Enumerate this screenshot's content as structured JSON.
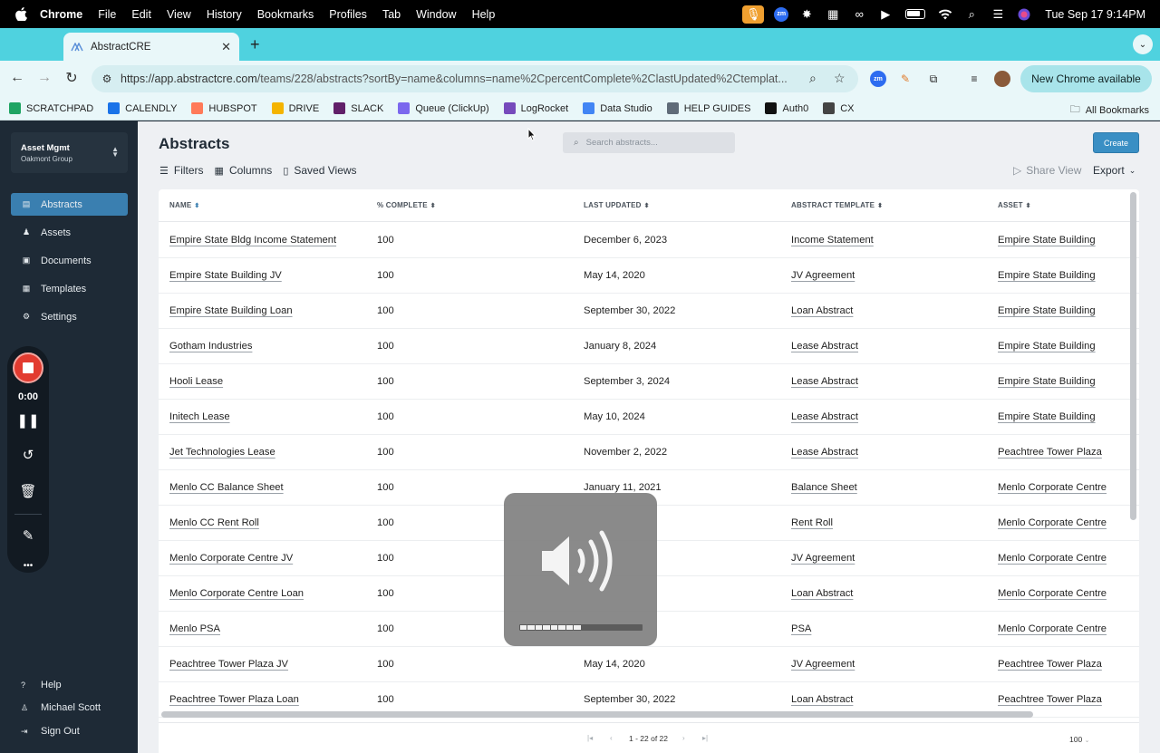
{
  "menubar": {
    "app": "Chrome",
    "items": [
      "File",
      "Edit",
      "View",
      "History",
      "Bookmarks",
      "Profiles",
      "Tab",
      "Window",
      "Help"
    ],
    "zoom_badge": "zm",
    "clock": "Tue Sep 17  9:14PM"
  },
  "browser": {
    "tab_title": "AbstractCRE",
    "url_host": "https://app.abstractcre.com",
    "url_path": "/teams/228/abstracts?sortBy=name&columns=name%2CpercentComplete%2ClastUpdated%2Ctemplat...",
    "update_label": "New Chrome available",
    "bookmarks": [
      {
        "label": "SCRATCHPAD",
        "icon": "scratchpad-icon",
        "color": "#1fa463"
      },
      {
        "label": "CALENDLY",
        "icon": "calendly-icon",
        "color": "#1a73e8"
      },
      {
        "label": "HUBSPOT",
        "icon": "hubspot-icon",
        "color": "#ff7a59"
      },
      {
        "label": "DRIVE",
        "icon": "drive-icon",
        "color": "#f4b400"
      },
      {
        "label": "SLACK",
        "icon": "slack-icon",
        "color": "#611f69"
      },
      {
        "label": "Queue (ClickUp)",
        "icon": "clickup-icon",
        "color": "#7b68ee"
      },
      {
        "label": "LogRocket",
        "icon": "logrocket-icon",
        "color": "#764abc"
      },
      {
        "label": "Data Studio",
        "icon": "datastudio-icon",
        "color": "#4285f4"
      },
      {
        "label": "HELP GUIDES",
        "icon": "book-icon",
        "color": "#5f6b78"
      },
      {
        "label": "Auth0",
        "icon": "auth0-icon",
        "color": "#111111"
      },
      {
        "label": "CX",
        "icon": "folder-icon",
        "color": "#444444"
      }
    ],
    "all_bookmarks": "All Bookmarks"
  },
  "sidebar": {
    "org_name": "Asset Mgmt",
    "org_sub": "Oakmont Group",
    "items": [
      {
        "label": "Abstracts",
        "icon": "abstracts-icon",
        "active": true
      },
      {
        "label": "Assets",
        "icon": "assets-icon",
        "active": false
      },
      {
        "label": "Documents",
        "icon": "documents-icon",
        "active": false
      },
      {
        "label": "Templates",
        "icon": "templates-icon",
        "active": false
      },
      {
        "label": "Settings",
        "icon": "settings-icon",
        "active": false
      }
    ],
    "bottom": [
      {
        "label": "Help",
        "icon": "help-icon"
      },
      {
        "label": "Michael Scott",
        "icon": "user-icon"
      },
      {
        "label": "Sign Out",
        "icon": "sign-out-icon"
      }
    ]
  },
  "recorder": {
    "time": "0:00"
  },
  "main": {
    "title": "Abstracts",
    "search_placeholder": "Search abstracts...",
    "create_label": "Create",
    "filters_label": "Filters",
    "columns_label": "Columns",
    "saved_views_label": "Saved Views",
    "share_view_label": "Share View",
    "export_label": "Export"
  },
  "table": {
    "columns": [
      "NAME",
      "% COMPLETE",
      "LAST UPDATED",
      "ABSTRACT TEMPLATE",
      "ASSET"
    ],
    "rows": [
      [
        "Empire State Bldg Income Statement",
        "100",
        "December 6, 2023",
        "Income Statement",
        "Empire State Building"
      ],
      [
        "Empire State Building JV",
        "100",
        "May 14, 2020",
        "JV Agreement",
        "Empire State Building"
      ],
      [
        "Empire State Building Loan",
        "100",
        "September 30, 2022",
        "Loan Abstract",
        "Empire State Building"
      ],
      [
        "Gotham Industries",
        "100",
        "January 8, 2024",
        "Lease Abstract",
        "Empire State Building"
      ],
      [
        "Hooli Lease",
        "100",
        "September 3, 2024",
        "Lease Abstract",
        "Empire State Building"
      ],
      [
        "Initech Lease",
        "100",
        "May 10, 2024",
        "Lease Abstract",
        "Empire State Building"
      ],
      [
        "Jet Technologies Lease",
        "100",
        "November 2, 2022",
        "Lease Abstract",
        "Peachtree Tower Plaza"
      ],
      [
        "Menlo CC Balance Sheet",
        "100",
        "January 11, 2021",
        "Balance Sheet",
        "Menlo Corporate Centre"
      ],
      [
        "Menlo CC Rent Roll",
        "100",
        "",
        "Rent Roll",
        "Menlo Corporate Centre"
      ],
      [
        "Menlo Corporate Centre JV",
        "100",
        "",
        "JV Agreement",
        "Menlo Corporate Centre"
      ],
      [
        "Menlo Corporate Centre Loan",
        "100",
        "",
        "Loan Abstract",
        "Menlo Corporate Centre"
      ],
      [
        "Menlo PSA",
        "100",
        "",
        "PSA",
        "Menlo Corporate Centre"
      ],
      [
        "Peachtree Tower Plaza JV",
        "100",
        "May 14, 2020",
        "JV Agreement",
        "Peachtree Tower Plaza"
      ],
      [
        "Peachtree Tower Plaza Loan",
        "100",
        "September 30, 2022",
        "Loan Abstract",
        "Peachtree Tower Plaza"
      ]
    ],
    "pagination": "1 - 22 of 22",
    "page_size": "100"
  },
  "volume": {
    "level_fraction": 0.5,
    "segments": 16
  },
  "colors": {
    "accent": "#3a7fb0",
    "create": "#3a8fc4",
    "sidebar_bg": "#1e2a36",
    "tabstrip": "#4fd2df",
    "record": "#e23b30"
  }
}
